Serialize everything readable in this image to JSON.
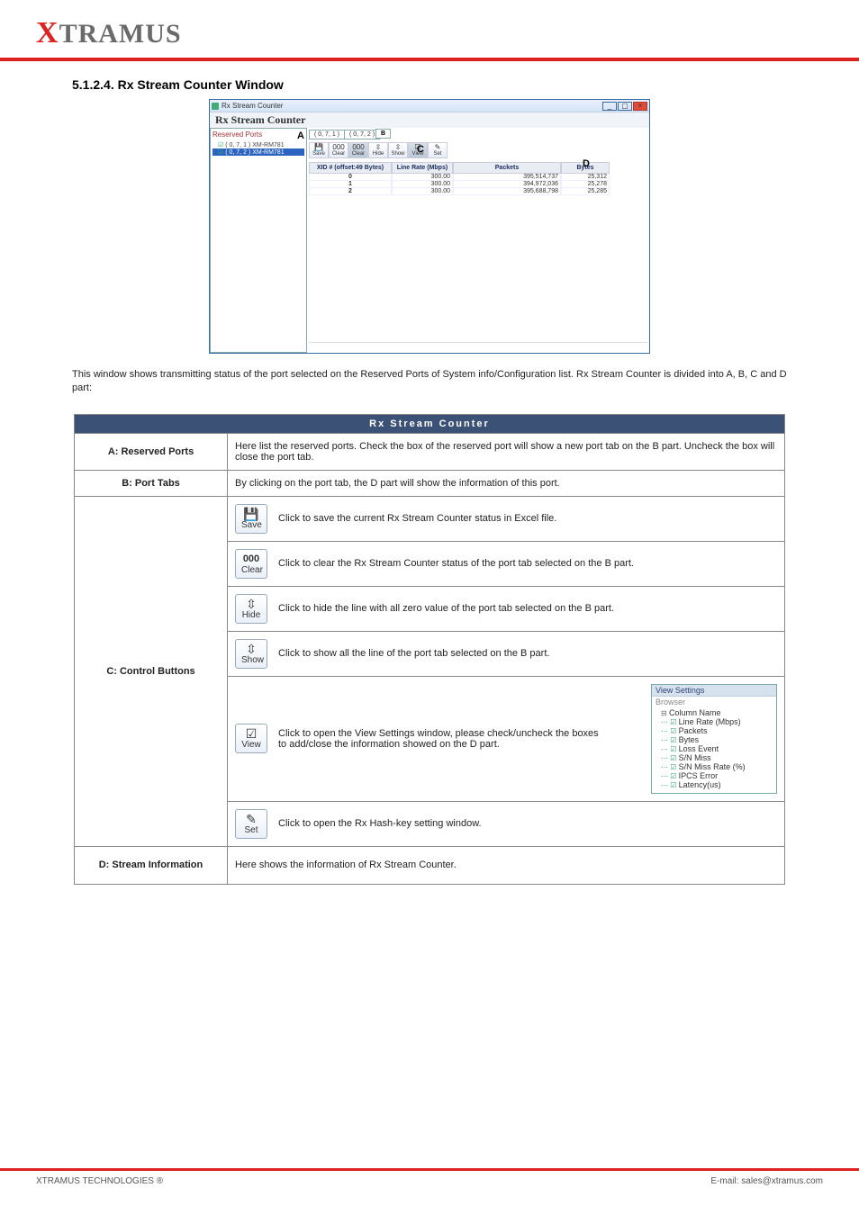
{
  "logo": {
    "x": "X",
    "rest": "TRAMUS"
  },
  "section_heading": "5.1.2.4. Rx Stream Counter Window",
  "window": {
    "title": "Rx Stream Counter",
    "main_title": "Rx Stream Counter",
    "sidebar": {
      "head": "Reserved Ports",
      "callout": "A",
      "items": [
        "( 0, 7, 1 ) XM-RM781",
        "( 0, 7, 2 ) XM-RM781"
      ]
    },
    "tabs": {
      "t1": "( 0, 7, 1 )",
      "t2": "( 0, 7, 2 )",
      "callout": "B"
    },
    "toolbar": {
      "save": "Save",
      "clear": "Clear",
      "clear2": "Clear",
      "hide": "Hide",
      "show": "Show",
      "view": "View",
      "set": "Set",
      "callout": "C"
    },
    "columns": {
      "c1": "XID # (offset:49 Bytes)",
      "c2": "Line Rate (Mbps)",
      "c3": "Packets",
      "c4": "Bytes",
      "callout": "D"
    },
    "rows": [
      {
        "xid": "0",
        "rate": "300.00",
        "pkt": "395,514,737",
        "bytes": "25,312"
      },
      {
        "xid": "1",
        "rate": "300.00",
        "pkt": "394,972,036",
        "bytes": "25,278"
      },
      {
        "xid": "2",
        "rate": "300.00",
        "pkt": "395,688,798",
        "bytes": "25,285"
      }
    ]
  },
  "description": "This window shows transmitting status of the port selected on the Reserved Ports of System info/Configuration list. Rx Stream Counter is divided into A, B, C and D part:",
  "table_header": "Rx Stream Counter",
  "rows": {
    "a": {
      "item": "A: Reserved Ports",
      "desc": "Here list the reserved ports. Check the box of the reserved port will show a new port tab on the B part. Uncheck the box will close the port tab."
    },
    "b": {
      "item": "B: Port Tabs",
      "desc": "By clicking on the port tab, the D part will show the information of this port."
    },
    "c": {
      "item": "C: Control Buttons",
      "tools": {
        "save": {
          "label": "Save",
          "desc": "Click to save the current Rx Stream Counter status in Excel file."
        },
        "clear": {
          "label": "Clear",
          "glyph": "000",
          "desc": "Click to clear the Rx Stream Counter status of the port tab selected on the B part."
        },
        "hide": {
          "label": "Hide",
          "desc": "Click to hide the line with all zero value of the port tab selected on the B part."
        },
        "show": {
          "label": "Show",
          "desc": "Click to show all the line of the port tab selected on the B part."
        },
        "view": {
          "label": "View",
          "desc": "Click to open the View Settings window, please check/uncheck the boxes to add/close the information showed on the D part."
        },
        "set": {
          "label": "Set",
          "desc": "Click to open the Rx Hash-key setting window."
        }
      },
      "view_panel": {
        "title": "View Settings",
        "sub": "Browser",
        "tree_head": "Column Name",
        "items": [
          "Line Rate (Mbps)",
          "Packets",
          "Bytes",
          "Loss Event",
          "S/N Miss",
          "S/N Miss Rate (%)",
          "IPCS Error",
          "Latency(us)"
        ]
      }
    },
    "d": {
      "item": "D: Stream Information",
      "desc": "Here shows the information of Rx Stream Counter."
    }
  },
  "footer": {
    "left": "XTRAMUS TECHNOLOGIES ®",
    "right": "E-mail: sales@xtramus.com"
  }
}
